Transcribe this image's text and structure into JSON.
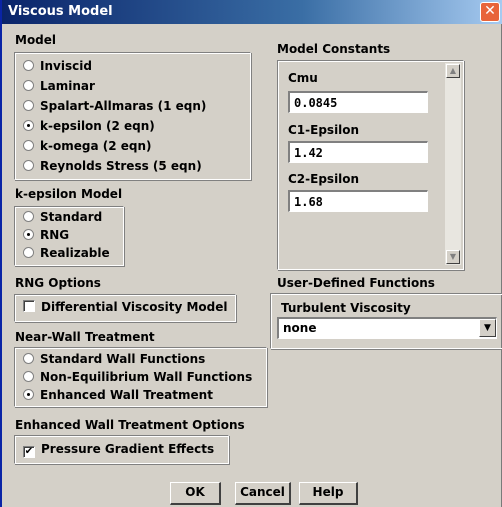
{
  "window": {
    "title": "Viscous Model",
    "close_glyph": "✕"
  },
  "model": {
    "label": "Model",
    "options": [
      "Inviscid",
      "Laminar",
      "Spalart-Allmaras  (1 eqn)",
      "k-epsilon  (2 eqn)",
      "k-omega  (2 eqn)",
      "Reynolds Stress  (5 eqn)"
    ],
    "selected": "k-epsilon  (2 eqn)"
  },
  "kepsilon": {
    "label": "k-epsilon Model",
    "options": [
      "Standard",
      "RNG",
      "Realizable"
    ],
    "selected": "RNG"
  },
  "rng": {
    "label": "RNG Options",
    "checkbox_label": "Differential Viscosity Model",
    "checked": false
  },
  "nearwall": {
    "label": "Near-Wall Treatment",
    "options": [
      "Standard Wall Functions",
      "Non-Equilibrium Wall Functions",
      "Enhanced Wall Treatment"
    ],
    "selected": "Enhanced Wall Treatment"
  },
  "enhanced": {
    "label": "Enhanced Wall Treatment Options",
    "checkbox_label": "Pressure Gradient Effects",
    "checked": true,
    "check_glyph": "✔"
  },
  "constants": {
    "label": "Model Constants",
    "fields": [
      {
        "label": "Cmu",
        "value": "0.0845"
      },
      {
        "label": "C1-Epsilon",
        "value": "1.42"
      },
      {
        "label": "C2-Epsilon",
        "value": "1.68"
      }
    ],
    "scroll_up_glyph": "▲",
    "scroll_down_glyph": "▼"
  },
  "udf": {
    "label": "User-Defined Functions",
    "turb_visc_label": "Turbulent Viscosity",
    "turb_visc_value": "none",
    "dropdown_glyph": "▼"
  },
  "buttons": {
    "ok": "OK",
    "cancel": "Cancel",
    "help": "Help"
  }
}
